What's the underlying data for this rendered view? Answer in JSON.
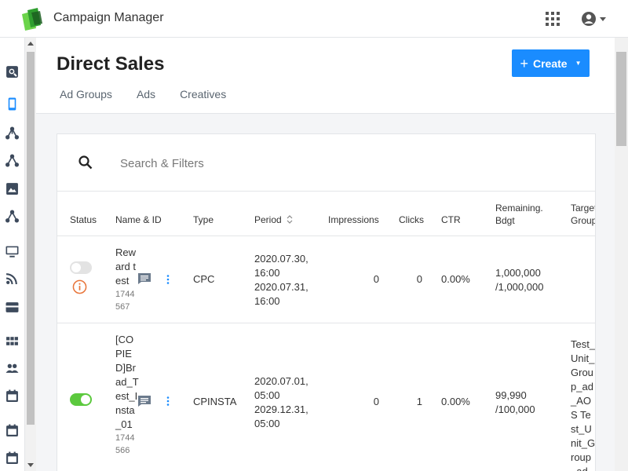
{
  "app": {
    "title": "Campaign Manager"
  },
  "header": {
    "title": "Direct Sales",
    "create_label": "Create",
    "tabs": [
      "Ad Groups",
      "Ads",
      "Creatives"
    ]
  },
  "search": {
    "placeholder": "Search & Filters"
  },
  "table": {
    "columns": [
      "Status",
      "Name & ID",
      "Type",
      "Period",
      "Impressions",
      "Clicks",
      "CTR",
      "Remaining.\nBdgt",
      "Target\nGroup"
    ],
    "rows": [
      {
        "status": "off",
        "name": "Reward test",
        "id": "1744567",
        "type": "CPC",
        "period_start": "2020.07.30, 16:00",
        "period_end": "2020.07.31, 16:00",
        "impressions": "0",
        "clicks": "0",
        "ctr": "0.00%",
        "remaining": "1,000,000",
        "budget": "/1,000,000",
        "target_group": ""
      },
      {
        "status": "on",
        "name": "[COPIED]Brad_Test_Insta_01",
        "id": "1744566",
        "type": "CPINSTA",
        "period_start": "2020.07.01, 05:00",
        "period_end": "2029.12.31, 05:00",
        "impressions": "0",
        "clicks": "1",
        "ctr": "0.00%",
        "remaining": "99,990",
        "budget": "/100,000",
        "target_group": "Test_Unit_Group_ad_AOS Test_Unit_Group_ad_IOS"
      }
    ]
  },
  "colors": {
    "accent": "#1a8cff",
    "toggle_on": "#5cc93e",
    "warning": "#e8753a",
    "logo_green": "#5cc93e"
  },
  "icons": {
    "rail": [
      "search-report-icon",
      "mobile-icon",
      "hierarchy-icon",
      "hierarchy-icon",
      "image-icon",
      "hierarchy-icon",
      "monitor-icon",
      "rss-icon",
      "card-icon",
      "grid-icon",
      "people-icon",
      "calendar-icon",
      "calendar-icon",
      "calendar-icon"
    ]
  }
}
